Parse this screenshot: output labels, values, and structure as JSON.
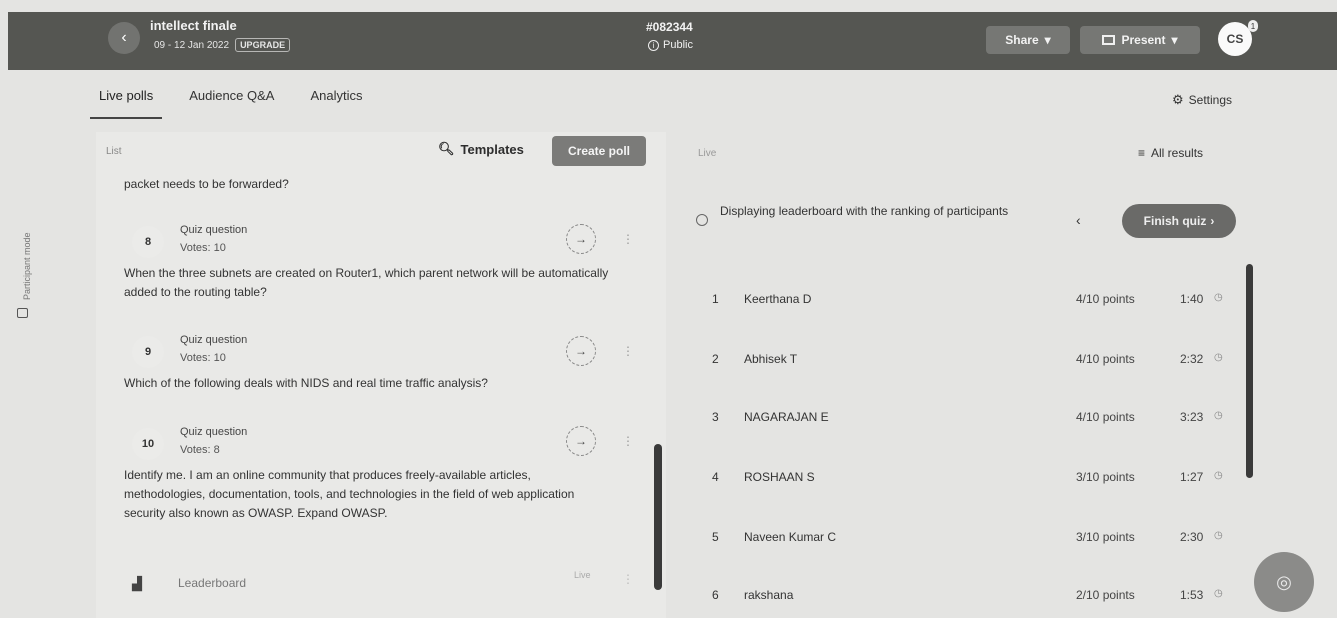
{
  "header": {
    "back_icon": "chevron-left-icon",
    "event_title": "intellect finale",
    "event_dates": "09 - 12 Jan 2022",
    "upgrade_label": "UPGRADE",
    "event_code": "#082344",
    "visibility_label": "Public",
    "share_label": "Share",
    "present_label": "Present",
    "avatar_initials": "CS",
    "avatar_badge": "1"
  },
  "side": {
    "participant_mode_label": "Participant mode"
  },
  "tabs": [
    {
      "label": "Live polls",
      "active": true
    },
    {
      "label": "Audience Q&A",
      "active": false
    },
    {
      "label": "Analytics",
      "active": false
    }
  ],
  "settings_label": "Settings",
  "left_panel": {
    "header_small": "List",
    "templates_label": "Templates",
    "create_poll_label": "Create poll",
    "top_text": "packet needs to be forwarded?",
    "polls": [
      {
        "number": "8",
        "type": "Quiz question",
        "votes": "Votes: 10",
        "text": "When the three subnets are created on Router1, which parent network will be automatically added to the routing table?"
      },
      {
        "number": "9",
        "type": "Quiz question",
        "votes": "Votes: 10",
        "text": "Which of the following deals with NIDS and real time traffic analysis?"
      },
      {
        "number": "10",
        "type": "Quiz question",
        "votes": "Votes: 8",
        "text": "Identify me. I am an online community that produces freely-available articles, methodologies, documentation, tools, and technologies in the field of web application security also known as OWASP. Expand OWASP."
      }
    ],
    "leaderboard_label": "Leaderboard",
    "leaderboard_live": "Live"
  },
  "right_panel": {
    "header_small": "Live",
    "all_results_label": "All results",
    "info_text": "Displaying leaderboard with the ranking of participants",
    "finish_quiz_label": "Finish quiz",
    "leaderboard": [
      {
        "rank": "1",
        "name": "Keerthana D",
        "points": "4/10 points",
        "time": "1:40"
      },
      {
        "rank": "2",
        "name": "Abhisek T",
        "points": "4/10 points",
        "time": "2:32"
      },
      {
        "rank": "3",
        "name": "NAGARAJAN E",
        "points": "4/10 points",
        "time": "3:23"
      },
      {
        "rank": "4",
        "name": "ROSHAAN S",
        "points": "3/10 points",
        "time": "1:27"
      },
      {
        "rank": "5",
        "name": "Naveen Kumar C",
        "points": "3/10 points",
        "time": "2:30"
      },
      {
        "rank": "6",
        "name": "rakshana",
        "points": "2/10 points",
        "time": "1:53"
      }
    ]
  }
}
